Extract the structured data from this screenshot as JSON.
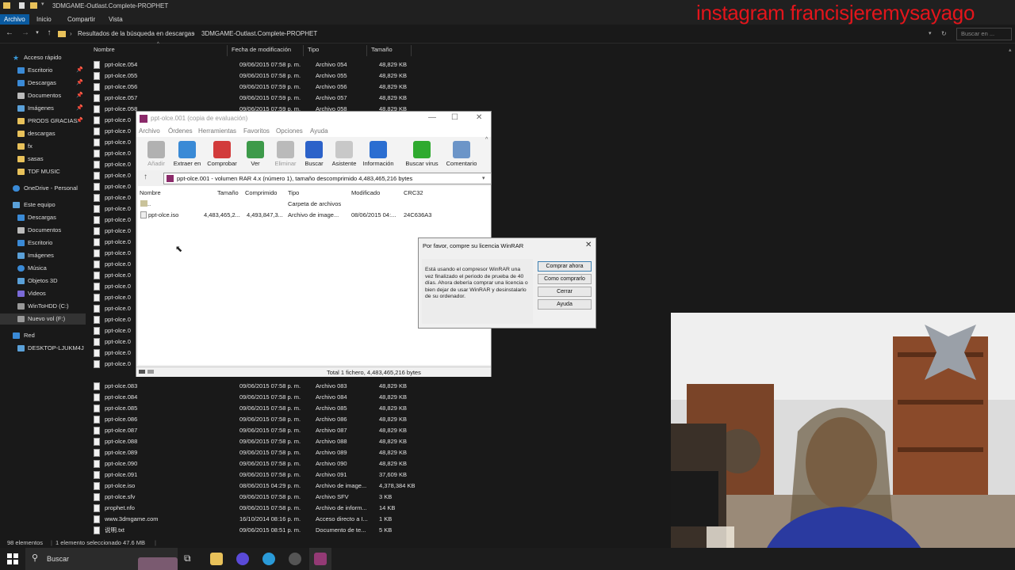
{
  "explorer": {
    "window_title": "3DMGAME-Outlast.Complete-PROPHET",
    "ribbon_tabs": [
      "Archivo",
      "Inicio",
      "Compartir",
      "Vista"
    ],
    "breadcrumb": [
      "Resultados de la búsqueda en descargas",
      "3DMGAME-Outlast.Complete-PROPHET"
    ],
    "search_placeholder": "Buscar en ...",
    "columns": {
      "name": "Nombre",
      "date": "Fecha de modificación",
      "type": "Tipo",
      "size": "Tamaño"
    },
    "nav": [
      {
        "label": "Acceso rápido",
        "pinned": false
      },
      {
        "label": "Escritorio",
        "pinned": true
      },
      {
        "label": "Descargas",
        "pinned": true
      },
      {
        "label": "Documentos",
        "pinned": true
      },
      {
        "label": "Imágenes",
        "pinned": true
      },
      {
        "label": "PRODS GRACIAS",
        "pinned": true
      },
      {
        "label": "descargas",
        "pinned": false
      },
      {
        "label": "fx",
        "pinned": false
      },
      {
        "label": "sasas",
        "pinned": false
      },
      {
        "label": "TDF MUSIC",
        "pinned": false
      },
      {
        "label": "OneDrive - Personal",
        "pinned": false
      },
      {
        "label": "Este equipo",
        "pinned": false
      },
      {
        "label": "Descargas",
        "pinned": false
      },
      {
        "label": "Documentos",
        "pinned": false
      },
      {
        "label": "Escritorio",
        "pinned": false
      },
      {
        "label": "Imágenes",
        "pinned": false
      },
      {
        "label": "Música",
        "pinned": false
      },
      {
        "label": "Objetos 3D",
        "pinned": false
      },
      {
        "label": "Videos",
        "pinned": false
      },
      {
        "label": "WinToHDD (C:)",
        "pinned": false
      },
      {
        "label": "Nuevo vol (F:)",
        "pinned": false
      },
      {
        "label": "Red",
        "pinned": false
      },
      {
        "label": "DESKTOP-LJUKM4J",
        "pinned": false
      }
    ],
    "files_top": [
      {
        "name": "ppt-olce.054",
        "date": "09/06/2015 07:58 p. m.",
        "type": "Archivo 054",
        "size": "48,829 KB"
      },
      {
        "name": "ppt-olce.055",
        "date": "09/06/2015 07:58 p. m.",
        "type": "Archivo 055",
        "size": "48,829 KB"
      },
      {
        "name": "ppt-olce.056",
        "date": "09/06/2015 07:59 p. m.",
        "type": "Archivo 056",
        "size": "48,829 KB"
      },
      {
        "name": "ppt-olce.057",
        "date": "09/06/2015 07:59 p. m.",
        "type": "Archivo 057",
        "size": "48,829 KB"
      },
      {
        "name": "ppt-olce.058",
        "date": "09/06/2015 07:59 p. m.",
        "type": "Archivo 058",
        "size": "48,829 KB"
      }
    ],
    "files_partial": [
      "ppt-olce.0",
      "ppt-olce.0",
      "ppt-olce.0",
      "ppt-olce.0",
      "ppt-olce.0",
      "ppt-olce.0",
      "ppt-olce.0",
      "ppt-olce.0",
      "ppt-olce.0",
      "ppt-olce.0",
      "ppt-olce.0",
      "ppt-olce.0",
      "ppt-olce.0",
      "ppt-olce.0",
      "ppt-olce.0",
      "ppt-olce.0",
      "ppt-olce.0",
      "ppt-olce.0",
      "ppt-olce.0",
      "ppt-olce.0",
      "ppt-olce.0",
      "ppt-olce.0",
      "ppt-olce.0"
    ],
    "files_bottom": [
      {
        "name": "ppt-olce.083",
        "date": "09/06/2015 07:58 p. m.",
        "type": "Archivo 083",
        "size": "48,829 KB"
      },
      {
        "name": "ppt-olce.084",
        "date": "09/06/2015 07:58 p. m.",
        "type": "Archivo 084",
        "size": "48,829 KB"
      },
      {
        "name": "ppt-olce.085",
        "date": "09/06/2015 07:58 p. m.",
        "type": "Archivo 085",
        "size": "48,829 KB"
      },
      {
        "name": "ppt-olce.086",
        "date": "09/06/2015 07:58 p. m.",
        "type": "Archivo 086",
        "size": "48,829 KB"
      },
      {
        "name": "ppt-olce.087",
        "date": "09/06/2015 07:58 p. m.",
        "type": "Archivo 087",
        "size": "48,829 KB"
      },
      {
        "name": "ppt-olce.088",
        "date": "09/06/2015 07:58 p. m.",
        "type": "Archivo 088",
        "size": "48,829 KB"
      },
      {
        "name": "ppt-olce.089",
        "date": "09/06/2015 07:58 p. m.",
        "type": "Archivo 089",
        "size": "48,829 KB"
      },
      {
        "name": "ppt-olce.090",
        "date": "09/06/2015 07:58 p. m.",
        "type": "Archivo 090",
        "size": "48,829 KB"
      },
      {
        "name": "ppt-olce.091",
        "date": "09/06/2015 07:58 p. m.",
        "type": "Archivo 091",
        "size": "37,609 KB"
      },
      {
        "name": "ppt-olce.iso",
        "date": "08/06/2015 04:29 p. m.",
        "type": "Archivo de image...",
        "size": "4,378,384 KB"
      },
      {
        "name": "ppt-olce.sfv",
        "date": "09/06/2015 07:58 p. m.",
        "type": "Archivo SFV",
        "size": "3 KB"
      },
      {
        "name": "prophet.nfo",
        "date": "09/06/2015 07:58 p. m.",
        "type": "Archivo de inform...",
        "size": "14 KB"
      },
      {
        "name": "www.3dmgame.com",
        "date": "16/10/2014 08:16 p. m.",
        "type": "Acceso directo a I...",
        "size": "1 KB"
      },
      {
        "name": "说明.txt",
        "date": "09/06/2015 08:51 p. m.",
        "type": "Documento de te...",
        "size": "5 KB"
      }
    ],
    "status": {
      "count": "98 elementos",
      "selection": "1 elemento seleccionado  47.6 MB"
    }
  },
  "taskbar": {
    "search_label": "Buscar"
  },
  "winrar": {
    "title": "ppt-olce.001 (copia de evaluación)",
    "menu": [
      "Archivo",
      "Órdenes",
      "Herramientas",
      "Favoritos",
      "Opciones",
      "Ayuda"
    ],
    "toolbar": [
      {
        "label": "Añadir",
        "color": "#7a7a7a",
        "disabled": true
      },
      {
        "label": "Extraer en",
        "color": "#3a8ad6",
        "disabled": false
      },
      {
        "label": "Comprobar",
        "color": "#d23b3b",
        "disabled": false
      },
      {
        "label": "Ver",
        "color": "#3d9a4a",
        "disabled": false
      },
      {
        "label": "Eliminar",
        "color": "#8a8a8a",
        "disabled": true
      },
      {
        "label": "Buscar",
        "color": "#2c62c9",
        "disabled": false
      },
      {
        "label": "Asistente",
        "color": "#c8c8c8",
        "disabled": false
      },
      {
        "label": "Información",
        "color": "#2b6ed1",
        "disabled": false
      },
      {
        "label": "Buscar virus",
        "color": "#2faa2f",
        "disabled": false
      },
      {
        "label": "Comentario",
        "color": "#6c95c8",
        "disabled": false
      }
    ],
    "path": "ppt-olce.001 - volumen RAR 4.x (número 1), tamaño descomprimido 4,483,465,216 bytes",
    "columns": {
      "name": "Nombre",
      "size": "Tamaño",
      "packed": "Comprimido",
      "type": "Tipo",
      "modified": "Modificado",
      "crc": "CRC32"
    },
    "rows": [
      {
        "name": "..",
        "size": "",
        "packed": "",
        "type": "Carpeta de archivos",
        "modified": "",
        "crc": ""
      },
      {
        "name": "ppt-olce.iso",
        "size": "4,483,465,2...",
        "packed": "4,493,847,3...",
        "type": "Archivo de image...",
        "modified": "08/06/2015 04:...",
        "crc": "24C636A3"
      }
    ],
    "status": "Total 1 fichero, 4,483,465,216 bytes"
  },
  "nag": {
    "title": "Por favor, compre su licencia WinRAR",
    "message": "Está usando el compresor WinRAR una vez finalizado el periodo de prueba de 40 días. Ahora debería comprar una licencia o bien dejar de usar WinRAR y desinstalarlo de su ordenador.",
    "buttons": [
      "Comprar ahora",
      "Como comprarlo",
      "Cerrar",
      "Ayuda"
    ]
  },
  "watermark": "instagram francisjeremysayago"
}
